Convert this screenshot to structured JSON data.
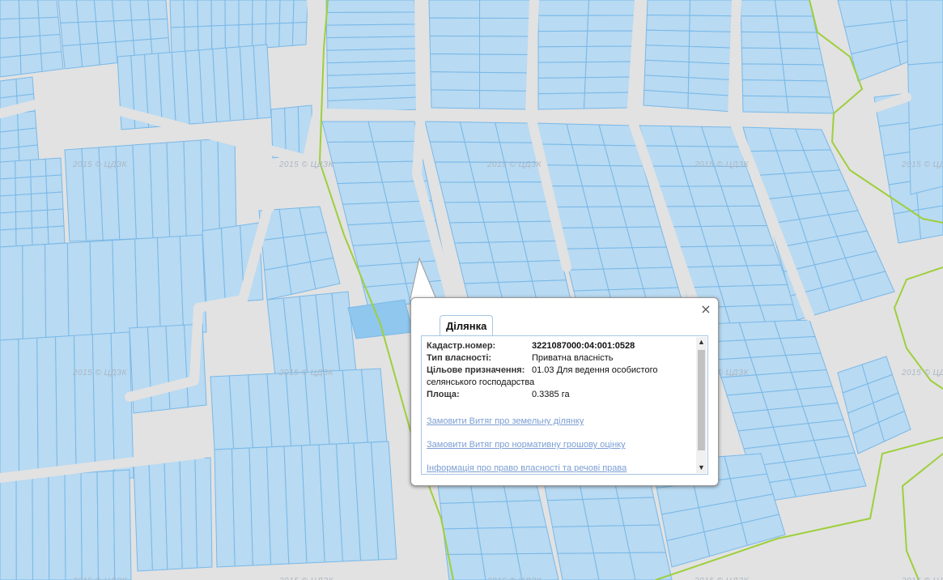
{
  "map": {
    "watermark": "2015 © ЦДЗК",
    "colors": {
      "background": "#e2e2e2",
      "parcel_fill": "#b8daf2",
      "parcel_stroke": "#79b8e8",
      "boundary": "#9ecf3c"
    }
  },
  "popup": {
    "tab_label": "Ділянка",
    "close_glyph": "×",
    "fields": {
      "cadastral_label": "Кадастр.номер:",
      "cadastral_value": "3221087000:04:001:0528",
      "ownership_label": "Тип власності:",
      "ownership_value": "Приватна власність",
      "purpose_label": "Цільове призначення:",
      "purpose_value_line1": "01.03 Для ведення особистого",
      "purpose_value_line2": "селянського господарства",
      "area_label": "Площа:",
      "area_value": "0.3385 га"
    },
    "links": {
      "extract_land": "Замовити Витяг про земельну ділянку",
      "extract_valuation": "Замовити Витяг про нормативну грошову оцінку",
      "ownership_info": "Інформація про право власності та речові права"
    },
    "scroll_up": "▲",
    "scroll_down": "▼"
  }
}
